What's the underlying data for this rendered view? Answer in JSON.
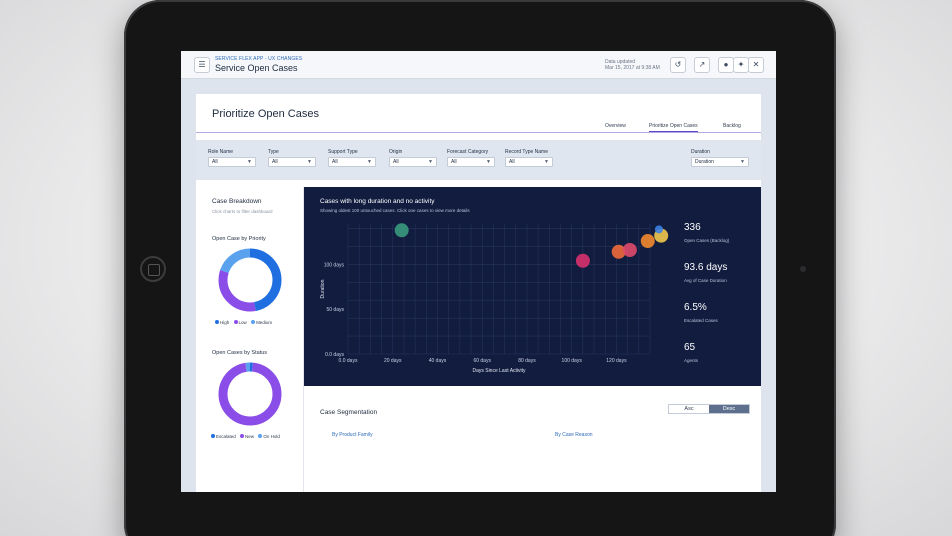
{
  "header": {
    "app_kicker": "SERVICE FLEX APP - UX CHANGES",
    "app_title": "Service Open Cases",
    "updated_line1": "Data updated",
    "updated_line2": "Mar 15, 2017 at 9:38 AM"
  },
  "page": {
    "title": "Prioritize Open Cases",
    "tabs": [
      {
        "label": "Overview"
      },
      {
        "label": "Prioritize Open Cases"
      },
      {
        "label": "Backlog"
      }
    ]
  },
  "filters": [
    {
      "label": "Role Name",
      "value": "All"
    },
    {
      "label": "Type",
      "value": "All"
    },
    {
      "label": "Support Type",
      "value": "All"
    },
    {
      "label": "Origin",
      "value": "All"
    },
    {
      "label": "Forecast Category",
      "value": "All"
    },
    {
      "label": "Record Type Name",
      "value": "All"
    },
    {
      "label": "Duration",
      "value": "Duration"
    }
  ],
  "breakdown": {
    "title": "Case Breakdown",
    "subtitle": "Click charts to filter dashboard",
    "priority": {
      "title": "Open Case by Priority",
      "segments": [
        {
          "label": "High",
          "value": 47,
          "color": "#1f6fe0"
        },
        {
          "label": "Low",
          "value": 33,
          "color": "#8a4de8"
        },
        {
          "label": "Medium",
          "value": 20,
          "color": "#5aa2ee"
        }
      ]
    },
    "status": {
      "title": "Open Cases by Status",
      "segments": [
        {
          "label": "Escalated",
          "value": 1.5,
          "color": "#1f6fe0"
        },
        {
          "label": "New",
          "value": 96,
          "color": "#8a4de8"
        },
        {
          "label": "On Hold",
          "value": 2.5,
          "color": "#5aa2ee"
        }
      ]
    }
  },
  "scatter": {
    "title": "Cases with long duration and no activity",
    "subtitle": "Showing oldest 100 untouched cases. Click one cases to view more details"
  },
  "kpis": [
    {
      "value": "336",
      "label": "Open Cases (Backlog)"
    },
    {
      "value": "93.6 days",
      "label": "Avg of Case Duration"
    },
    {
      "value": "6.5%",
      "label": "Escalated Cases"
    },
    {
      "value": "65",
      "label": "Agents"
    }
  ],
  "segmentation": {
    "title": "Case Segmentation",
    "asc_label": "Asc",
    "desc_label": "Desc",
    "by_product": "By Product Family",
    "by_reason": "By Case Reason"
  },
  "chart_data": {
    "type": "scatter",
    "title": "Cases with long duration and no activity",
    "xlabel": "Days Since Last Activity",
    "ylabel": "Duration",
    "x_ticks": [
      "0.0 days",
      "20 days",
      "40 days",
      "60 days",
      "80 days",
      "100 days",
      "120 days"
    ],
    "y_ticks": [
      "0.0 days",
      "50 days",
      "100 days"
    ],
    "x_tick_values": [
      0,
      20,
      40,
      60,
      80,
      100,
      120
    ],
    "y_tick_values": [
      0,
      50,
      100
    ],
    "xlim": [
      0,
      135
    ],
    "ylim": [
      0,
      145
    ],
    "grid": true,
    "points": [
      {
        "x": 24,
        "y": 138,
        "r": 7,
        "color": "#3a9a7e"
      },
      {
        "x": 105,
        "y": 104,
        "r": 7,
        "color": "#d8316e"
      },
      {
        "x": 121,
        "y": 114,
        "r": 7,
        "color": "#f06a3a"
      },
      {
        "x": 126,
        "y": 116,
        "r": 7,
        "color": "#e04a6a"
      },
      {
        "x": 134,
        "y": 126,
        "r": 7,
        "color": "#f28a2e"
      },
      {
        "x": 140,
        "y": 132,
        "r": 7,
        "color": "#f2c94c"
      },
      {
        "x": 139,
        "y": 139,
        "r": 4,
        "color": "#3b82e6"
      }
    ]
  }
}
